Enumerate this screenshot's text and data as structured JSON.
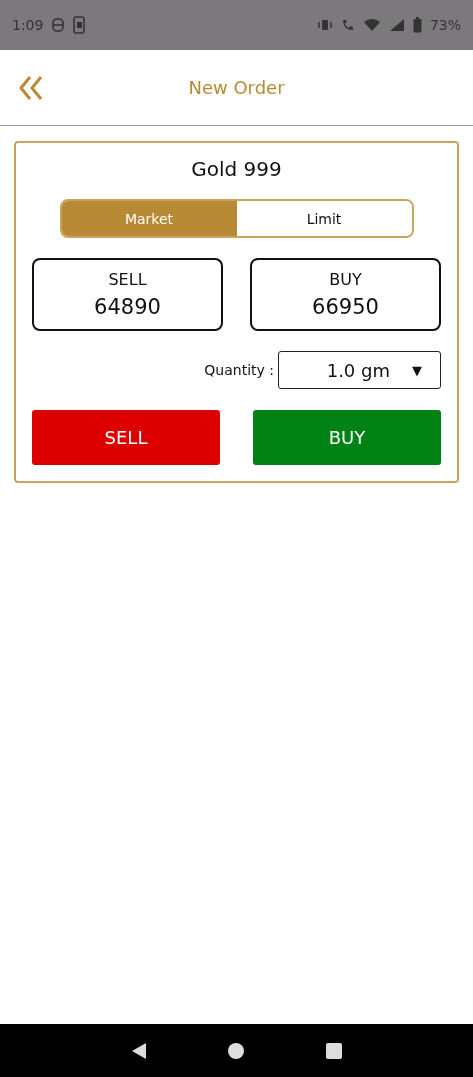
{
  "status_bar": {
    "time": "1:09",
    "battery": "73%"
  },
  "header": {
    "title": "New Order"
  },
  "order": {
    "instrument": "Gold 999",
    "order_types": [
      {
        "label": "Market",
        "selected": true
      },
      {
        "label": "Limit",
        "selected": false
      }
    ],
    "prices": [
      {
        "label": "SELL",
        "value": "64890"
      },
      {
        "label": "BUY",
        "value": "66950"
      }
    ],
    "quantity": {
      "label": "Quantity :",
      "value": "1.0 gm",
      "arrow": "▼"
    },
    "actions": [
      {
        "label": "SELL",
        "kind": "sell"
      },
      {
        "label": "BUY",
        "kind": "buy"
      }
    ]
  }
}
